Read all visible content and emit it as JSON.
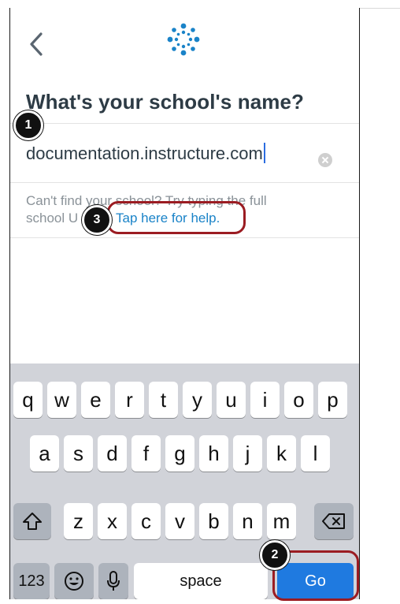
{
  "header": {
    "back_icon": "chevron-left-icon",
    "logo_icon": "canvas-logo-icon",
    "brand_color": "#1a83c8"
  },
  "title": "What's your school's name?",
  "search": {
    "value": "documentation.instructure.com",
    "clear_icon": "clear-icon"
  },
  "help": {
    "line1": "Can't find your school? Try typing the full",
    "line2_prefix": "school U",
    "link": "Tap here for help."
  },
  "keyboard": {
    "row1": [
      "q",
      "w",
      "e",
      "r",
      "t",
      "y",
      "u",
      "i",
      "o",
      "p"
    ],
    "row2": [
      "a",
      "s",
      "d",
      "f",
      "g",
      "h",
      "j",
      "k",
      "l"
    ],
    "row3": [
      "z",
      "x",
      "c",
      "v",
      "b",
      "n",
      "m"
    ],
    "shift_icon": "shift-icon",
    "delete_icon": "backspace-icon",
    "numbers": "123",
    "emoji_icon": "emoji-icon",
    "mic_icon": "microphone-icon",
    "space": "space",
    "go": "Go"
  },
  "callouts": [
    "1",
    "2",
    "3"
  ],
  "colors": {
    "callout_ring": "#9b1c22",
    "go_key": "#1f7ae0",
    "title": "#2d3b45"
  }
}
